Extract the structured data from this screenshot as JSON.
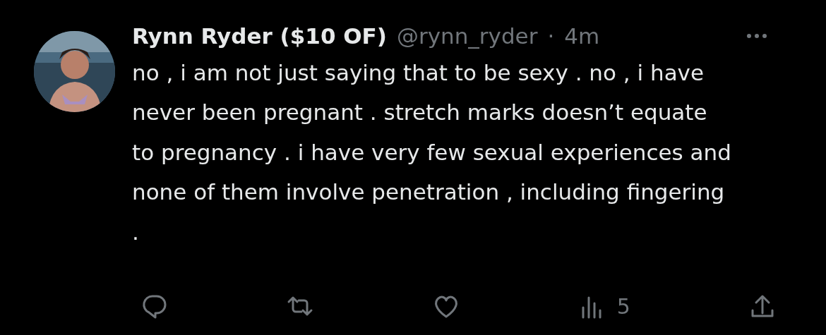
{
  "post": {
    "author_name": "Rynn Ryder ($10 OF)",
    "handle": "@rynn_ryder",
    "separator": "·",
    "time": "4m",
    "text": "no , i am not just saying that to be sexy . no , i have never been pregnant . stretch marks doesn’t equate to pregnancy . i have very few sexual experiences and none of them involve penetration , including fingering ."
  },
  "actions": [
    {
      "kind": "reply"
    },
    {
      "kind": "repost"
    },
    {
      "kind": "like"
    },
    {
      "kind": "views",
      "count": "5"
    },
    {
      "kind": "share"
    }
  ]
}
